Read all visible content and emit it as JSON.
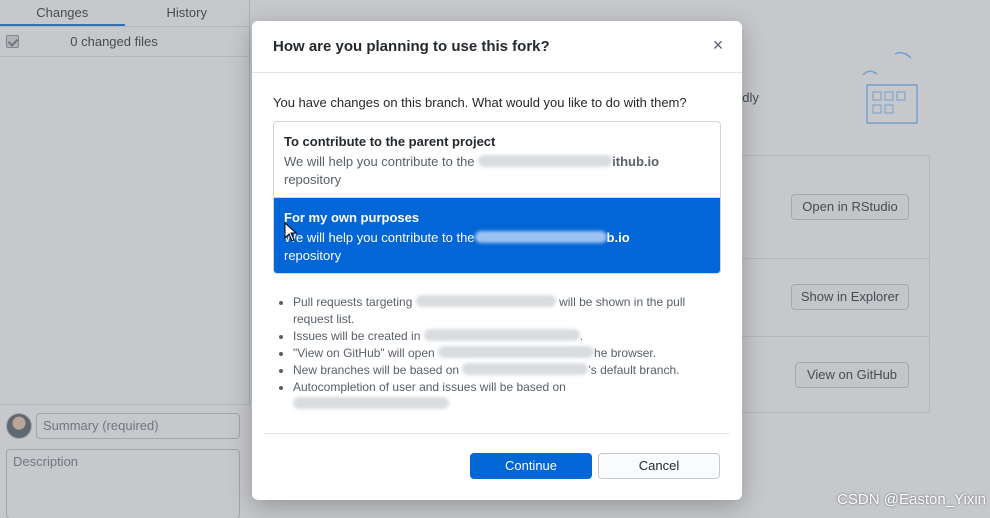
{
  "sidebar": {
    "tabs": [
      {
        "label": "Changes",
        "active": true
      },
      {
        "label": "History",
        "active": false
      }
    ],
    "changed_files_label": "0 changed files",
    "commit": {
      "summary_placeholder": "Summary (required)",
      "description_placeholder": "Description"
    }
  },
  "main": {
    "friendly_text": "ndly",
    "actions": [
      {
        "label": "Open in RStudio"
      },
      {
        "label": "Show in Explorer"
      },
      {
        "label": "View on GitHub"
      }
    ]
  },
  "dialog": {
    "title": "How are you planning to use this fork?",
    "close_glyph": "×",
    "question": "You have changes on this branch. What would you like to do with them?",
    "options": [
      {
        "title": "To contribute to the parent project",
        "desc_prefix": "We will help you contribute to the ",
        "desc_visible_suffix": "ithub.io",
        "desc_line2": "repository",
        "selected": false
      },
      {
        "title": "For my own purposes",
        "desc_prefix": "We will help you contribute to the",
        "desc_visible_suffix": "b.io",
        "desc_line2": "repository",
        "selected": true
      }
    ],
    "bullets": [
      {
        "before": "Pull requests targeting ",
        "after": " will be shown in the pull request list."
      },
      {
        "before": "Issues will be created in ",
        "after": "."
      },
      {
        "before": "\"View on GitHub\" will open ",
        "after": "he browser."
      },
      {
        "before": "New branches will be based on ",
        "after": "'s default branch."
      },
      {
        "before": "Autocompletion of user and issues will be based on",
        "after": ""
      }
    ],
    "continue_label": "Continue",
    "cancel_label": "Cancel"
  },
  "watermark": "CSDN @Easton_Yixin",
  "colors": {
    "accent": "#0366d6",
    "overlay": "rgba(120,124,130,0.42)"
  }
}
